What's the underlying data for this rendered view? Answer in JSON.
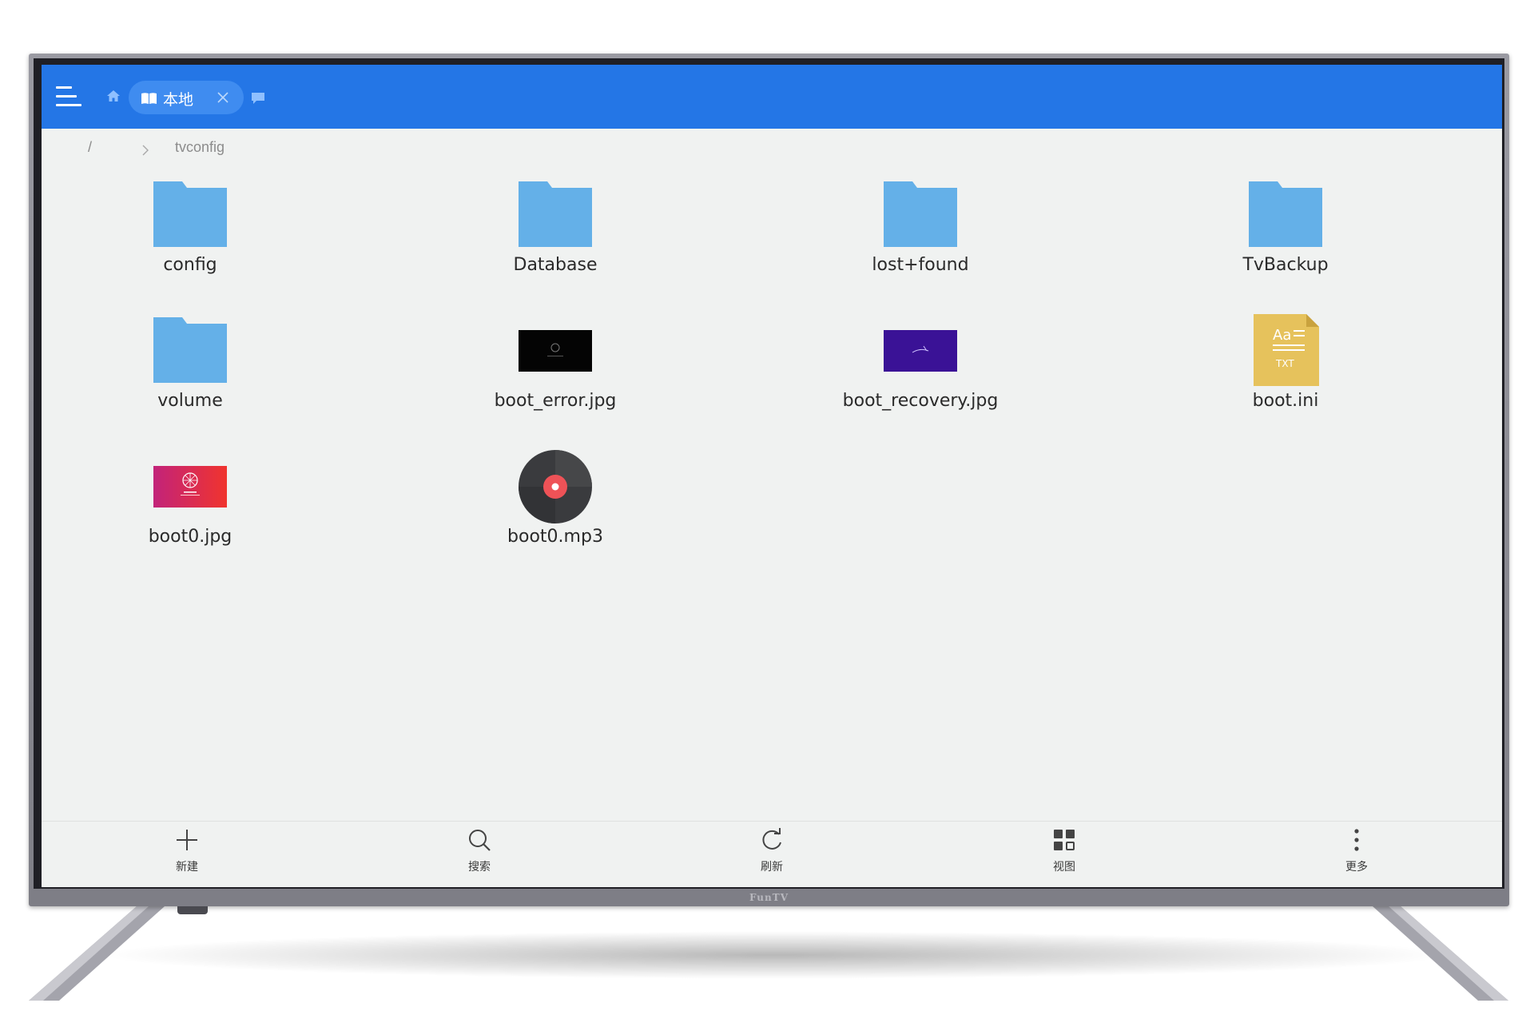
{
  "tv": {
    "brand": "FunTV"
  },
  "topbar": {
    "tab_label": "本地"
  },
  "breadcrumb": {
    "root": "/",
    "current": "tvconfig"
  },
  "files": [
    {
      "name": "config",
      "type": "folder"
    },
    {
      "name": "Database",
      "type": "folder"
    },
    {
      "name": "lost+found",
      "type": "folder"
    },
    {
      "name": "TvBackup",
      "type": "folder"
    },
    {
      "name": "volume",
      "type": "folder"
    },
    {
      "name": "boot_error.jpg",
      "type": "image"
    },
    {
      "name": "boot_recovery.jpg",
      "type": "image"
    },
    {
      "name": "boot.ini",
      "type": "text"
    },
    {
      "name": "boot0.jpg",
      "type": "image"
    },
    {
      "name": "boot0.mp3",
      "type": "audio"
    }
  ],
  "bottombar": {
    "new_label": "新建",
    "search_label": "搜索",
    "refresh_label": "刷新",
    "view_label": "视图",
    "more_label": "更多"
  },
  "colors": {
    "accent": "#2476e6",
    "folder": "#64b0e8",
    "background": "#f0f2f1"
  }
}
